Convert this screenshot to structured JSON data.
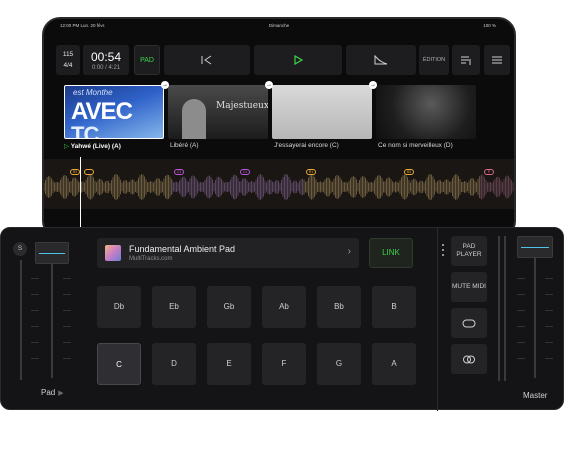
{
  "status_bar": {
    "left": "12:00 PM  Lun. 20 févr.",
    "center": "Dimanche",
    "right": "100 %"
  },
  "toolbar": {
    "tempo": "115",
    "signature": "4/4",
    "time_big": "00:54",
    "time_small": "0:00 / 4:21",
    "pad_label": "PAD",
    "edit_label": "ÉDITION",
    "prev_icon": "skip-back-icon",
    "play_icon": "play-icon",
    "fade_icon": "fade-out-icon",
    "list_icon": "playlist-icon",
    "menu_icon": "hamburger-icon"
  },
  "thumb_text": {
    "avec": "AVEC",
    "tc": "TC",
    "script": "est Monthe",
    "majestueux": "Majestueux"
  },
  "setlist": [
    {
      "title": "Yahwé (Live) (A)",
      "active": true
    },
    {
      "title": "Libéré (A)",
      "active": false
    },
    {
      "title": "J'essayerai encore (C)",
      "active": false
    },
    {
      "title": "Ce nom si merveilleux (D)",
      "active": false
    }
  ],
  "wave_markers": [
    "R2",
    "C3",
    "C4",
    "R1",
    "R2",
    "P"
  ],
  "pad_player": {
    "solo_label": "S",
    "channel_label": "Pad",
    "song_title": "Fundamental Ambient Pad",
    "song_source": "MultiTracks.com",
    "link_label": "LINK",
    "keys_row1": [
      "Db",
      "Eb",
      "Gb",
      "Ab",
      "Bb",
      "B"
    ],
    "keys_row2": [
      "C",
      "D",
      "E",
      "F",
      "G",
      "A"
    ],
    "selected_key": "C",
    "pad_player_btn": "PAD PLAYER",
    "mute_midi_btn": "MUTE MIDI",
    "loop_icon": "loop-icon",
    "crossfade_icon": "crossfade-icon",
    "master_label": "Master"
  },
  "colors": {
    "accent_green": "#3ed24a",
    "fader_blue": "#4fc3e6",
    "marker_orange": "#e8a93a"
  }
}
